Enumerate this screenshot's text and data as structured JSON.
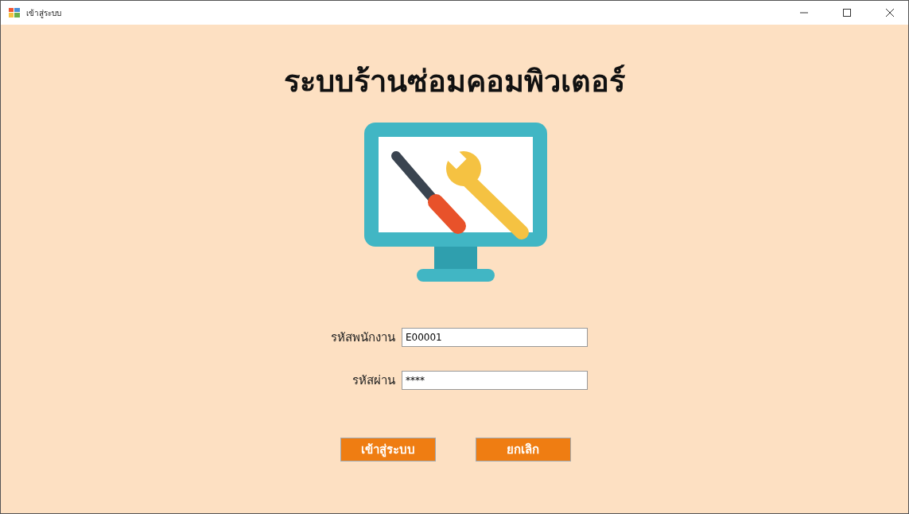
{
  "window": {
    "title": "เข้าสู่ระบบ"
  },
  "heading": "ระบบร้านซ่อมคอมพิวเตอร์",
  "fields": [
    {
      "label": "รหัสพนักงาน",
      "value": "E00001"
    },
    {
      "label": "รหัสผ่าน",
      "value": "****"
    }
  ],
  "buttons": [
    "เข้าสู่ระบบ",
    "ยกเลิก"
  ]
}
